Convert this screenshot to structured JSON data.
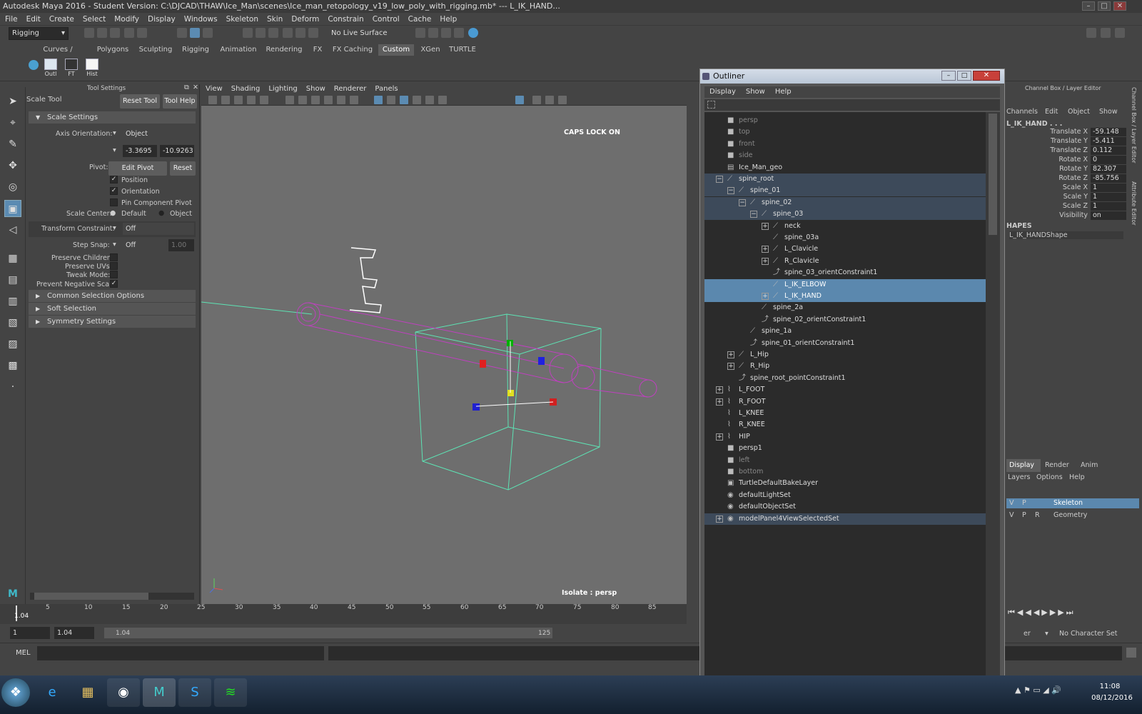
{
  "window": {
    "title": "Autodesk Maya 2016 - Student Version: C:\\DJCAD\\THAW\\Ice_Man\\scenes\\Ice_man_retopology_v19_low_poly_with_rigging.mb*   ---   L_IK_HAND..."
  },
  "menubar": [
    "File",
    "Edit",
    "Create",
    "Select",
    "Modify",
    "Display",
    "Windows",
    "Skeleton",
    "Skin",
    "Deform",
    "Constrain",
    "Control",
    "Cache",
    "Help"
  ],
  "status": {
    "menuset": "Rigging",
    "live_surface": "No Live Surface"
  },
  "shelf": {
    "tabs": [
      "Curves / Surfaces",
      "Polygons",
      "Sculpting",
      "Rigging",
      "Animation",
      "Rendering",
      "FX",
      "FX Caching",
      "Custom",
      "XGen",
      "TURTLE"
    ],
    "active_tab": "Custom",
    "buttons": [
      "Outl",
      "FT",
      "Hist"
    ]
  },
  "tool_settings": {
    "panel_title": "Tool Settings",
    "tool_name": "Scale Tool",
    "reset_tool": "Reset Tool",
    "tool_help": "Tool Help",
    "section": "Scale Settings",
    "axis_orientation_label": "Axis Orientation:",
    "axis_orientation_value": "Object",
    "axis_x": "-3.3695",
    "axis_y": "-10.9263",
    "pivot_label": "Pivot:",
    "edit_pivot": "Edit Pivot",
    "reset": "Reset",
    "position": "Position",
    "orientation": "Orientation",
    "pin_component_pivot": "Pin Component Pivot",
    "scale_center_label": "Scale Center:",
    "scale_center_default": "Default",
    "scale_center_object": "Object",
    "transform_constraint_label": "Transform Constraint:",
    "transform_constraint_value": "Off",
    "step_snap_label": "Step Snap:",
    "step_snap_value": "Off",
    "step_snap_amount": "1.00",
    "preserve_children": "Preserve Children:",
    "preserve_uvs": "Preserve UVs:",
    "tweak_mode": "Tweak Mode:",
    "prevent_negative_scale": "Prevent Negative Scale:",
    "sections": [
      "Common Selection Options",
      "Soft Selection",
      "Symmetry Settings"
    ]
  },
  "viewport": {
    "menu": [
      "View",
      "Shading",
      "Lighting",
      "Show",
      "Renderer",
      "Panels"
    ],
    "caps_lock": "CAPS LOCK ON",
    "isolate": "Isolate : persp",
    "letter": "E"
  },
  "timeline": {
    "current": "1.04",
    "ticks": [
      "5",
      "10",
      "15",
      "20",
      "25",
      "30",
      "35",
      "40",
      "45",
      "50",
      "55",
      "60",
      "65",
      "70",
      "75",
      "80",
      "85"
    ],
    "start": "1",
    "range_start": "1.04",
    "slider_start": "1.04",
    "slider_end": "125"
  },
  "command_line": {
    "label": "MEL"
  },
  "outliner": {
    "title": "Outliner",
    "menu": [
      "Display",
      "Show",
      "Help"
    ],
    "rows": [
      {
        "label": "persp",
        "indent": 0,
        "exp": "",
        "dim": true,
        "icon": "camera",
        "state": ""
      },
      {
        "label": "top",
        "indent": 0,
        "exp": "",
        "dim": true,
        "icon": "camera",
        "state": ""
      },
      {
        "label": "front",
        "indent": 0,
        "exp": "",
        "dim": true,
        "icon": "camera",
        "state": ""
      },
      {
        "label": "side",
        "indent": 0,
        "exp": "",
        "dim": true,
        "icon": "camera",
        "state": ""
      },
      {
        "label": "Ice_Man_geo",
        "indent": 0,
        "exp": "",
        "dim": false,
        "icon": "mesh",
        "state": ""
      },
      {
        "label": "spine_root",
        "indent": 0,
        "exp": "−",
        "dim": false,
        "icon": "joint",
        "state": "hl"
      },
      {
        "label": "spine_01",
        "indent": 1,
        "exp": "−",
        "dim": false,
        "icon": "joint",
        "state": "hl"
      },
      {
        "label": "spine_02",
        "indent": 2,
        "exp": "−",
        "dim": false,
        "icon": "joint",
        "state": "hl"
      },
      {
        "label": "spine_03",
        "indent": 3,
        "exp": "−",
        "dim": false,
        "icon": "joint",
        "state": "hl"
      },
      {
        "label": "neck",
        "indent": 4,
        "exp": "+",
        "dim": false,
        "icon": "joint",
        "state": ""
      },
      {
        "label": "spine_03a",
        "indent": 4,
        "exp": "",
        "dim": false,
        "icon": "joint",
        "state": ""
      },
      {
        "label": "L_Clavicle",
        "indent": 4,
        "exp": "+",
        "dim": false,
        "icon": "joint",
        "state": ""
      },
      {
        "label": "R_Clavicle",
        "indent": 4,
        "exp": "+",
        "dim": false,
        "icon": "joint",
        "state": ""
      },
      {
        "label": "spine_03_orientConstraint1",
        "indent": 4,
        "exp": "",
        "dim": false,
        "icon": "constraint",
        "state": ""
      },
      {
        "label": "L_IK_ELBOW",
        "indent": 4,
        "exp": "",
        "dim": false,
        "icon": "joint",
        "state": "sel"
      },
      {
        "label": "L_IK_HAND",
        "indent": 4,
        "exp": "+",
        "dim": false,
        "icon": "joint",
        "state": "sel"
      },
      {
        "label": "spine_2a",
        "indent": 3,
        "exp": "",
        "dim": false,
        "icon": "joint",
        "state": ""
      },
      {
        "label": "spine_02_orientConstraint1",
        "indent": 3,
        "exp": "",
        "dim": false,
        "icon": "constraint",
        "state": ""
      },
      {
        "label": "spine_1a",
        "indent": 2,
        "exp": "",
        "dim": false,
        "icon": "joint",
        "state": ""
      },
      {
        "label": "spine_01_orientConstraint1",
        "indent": 2,
        "exp": "",
        "dim": false,
        "icon": "constraint",
        "state": ""
      },
      {
        "label": "L_Hip",
        "indent": 1,
        "exp": "+",
        "dim": false,
        "icon": "joint",
        "state": ""
      },
      {
        "label": "R_Hip",
        "indent": 1,
        "exp": "+",
        "dim": false,
        "icon": "joint",
        "state": ""
      },
      {
        "label": "spine_root_pointConstraint1",
        "indent": 1,
        "exp": "",
        "dim": false,
        "icon": "constraint",
        "state": ""
      },
      {
        "label": "L_FOOT",
        "indent": 0,
        "exp": "+",
        "dim": false,
        "icon": "curve",
        "state": ""
      },
      {
        "label": "R_FOOT",
        "indent": 0,
        "exp": "+",
        "dim": false,
        "icon": "curve",
        "state": ""
      },
      {
        "label": "L_KNEE",
        "indent": 0,
        "exp": "",
        "dim": false,
        "icon": "curve",
        "state": ""
      },
      {
        "label": "R_KNEE",
        "indent": 0,
        "exp": "",
        "dim": false,
        "icon": "curve",
        "state": ""
      },
      {
        "label": "HIP",
        "indent": 0,
        "exp": "+",
        "dim": false,
        "icon": "curve",
        "state": ""
      },
      {
        "label": "persp1",
        "indent": 0,
        "exp": "",
        "dim": false,
        "icon": "camera",
        "state": ""
      },
      {
        "label": "left",
        "indent": 0,
        "exp": "",
        "dim": true,
        "icon": "camera",
        "state": ""
      },
      {
        "label": "bottom",
        "indent": 0,
        "exp": "",
        "dim": true,
        "icon": "camera",
        "state": ""
      },
      {
        "label": "TurtleDefaultBakeLayer",
        "indent": 0,
        "exp": "",
        "dim": false,
        "icon": "layer",
        "state": ""
      },
      {
        "label": "defaultLightSet",
        "indent": 0,
        "exp": "",
        "dim": false,
        "icon": "set",
        "state": ""
      },
      {
        "label": "defaultObjectSet",
        "indent": 0,
        "exp": "",
        "dim": false,
        "icon": "set",
        "state": ""
      },
      {
        "label": "modelPanel4ViewSelectedSet",
        "indent": 0,
        "exp": "+",
        "dim": false,
        "icon": "set",
        "state": "hl"
      }
    ]
  },
  "channel_box": {
    "title": "Channel Box / Layer Editor",
    "menu": [
      "Channels",
      "Edit",
      "Object",
      "Show"
    ],
    "object": "L_IK_HAND . . .",
    "attrs": [
      {
        "name": "Translate X",
        "value": "-59.148"
      },
      {
        "name": "Translate Y",
        "value": "-5.411"
      },
      {
        "name": "Translate Z",
        "value": "0.112"
      },
      {
        "name": "Rotate X",
        "value": "0"
      },
      {
        "name": "Rotate Y",
        "value": "82.307"
      },
      {
        "name": "Rotate Z",
        "value": "-85.756"
      },
      {
        "name": "Scale X",
        "value": "1"
      },
      {
        "name": "Scale Y",
        "value": "1"
      },
      {
        "name": "Scale Z",
        "value": "1"
      },
      {
        "name": "Visibility",
        "value": "on"
      }
    ],
    "shapes_header": "HAPES",
    "shape_name": "L_IK_HANDShape",
    "layer_tabs": [
      "Display",
      "Render",
      "Anim"
    ],
    "layer_menu": [
      "Layers",
      "Options",
      "Help"
    ],
    "layers": [
      {
        "v": "V",
        "p": "P",
        "r": "",
        "name": "Skeleton",
        "selected": true
      },
      {
        "v": "V",
        "p": "P",
        "r": "R",
        "name": "Geometry",
        "selected": false
      }
    ],
    "side_tabs": [
      "Channel Box / Layer Editor",
      "Attribute Editor"
    ],
    "character_set": "No Character Set",
    "char_label": "er"
  },
  "taskbar": {
    "time": "11:08",
    "date": "08/12/2016"
  },
  "colors": {
    "selection": "#5b88ae",
    "bounding_box": "#5de3b4",
    "joint": "#c040c0",
    "accent": "#5b8bb2"
  }
}
